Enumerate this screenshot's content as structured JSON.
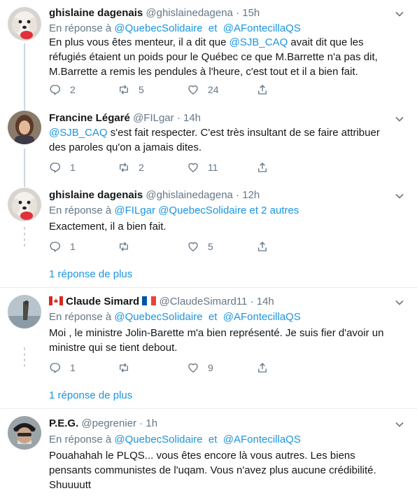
{
  "tweets": [
    {
      "name": "ghislaine dagenais",
      "handle": "@ghislainedagena",
      "dot": "·",
      "time": "15h",
      "reply_prefix": "En réponse à",
      "reply_m1": "@QuebecSolidaire",
      "reply_sep": "et",
      "reply_m2": "@AFontecillaQS",
      "text_line1_mention": "",
      "text": "En plus vous êtes menteur, il a dit que",
      "text_mention": "@SJB_CAQ",
      "text_rest": " avait dit que les réfugiés étaient un poids pour le Québec ce que M.Barrette n'a pas dit, M.Barrette a remis les pendules à l'heure, c'est tout et il a bien fait.",
      "replies": "2",
      "retweets": "5",
      "likes": "24",
      "avatar": "dog-avatar"
    },
    {
      "name": "Francine Légaré",
      "handle": "@FILgar",
      "dot": "·",
      "time": "14h",
      "text_mention": "@SJB_CAQ",
      "text_rest": " s'est fait respecter. C'est très insultant de se faire attribuer des paroles qu'on a jamais dites.",
      "replies": "1",
      "retweets": "2",
      "likes": "11",
      "avatar": "woman-avatar"
    },
    {
      "name": "ghislaine dagenais",
      "handle": "@ghislainedagena",
      "dot": "·",
      "time": "12h",
      "reply_prefix": "En réponse à",
      "reply_m1": "@FILgar",
      "reply_m2": "@QuebecSolidaire",
      "reply_others": "et 2 autres",
      "text": "Exactement, il a bien fait.",
      "replies": "1",
      "retweets": "",
      "likes": "5",
      "avatar": "dog-avatar"
    },
    {
      "name": "Claude Simard",
      "handle": "@ClaudeSimard11",
      "dot": "·",
      "time": "14h",
      "reply_prefix": "En réponse à",
      "reply_m1": "@QuebecSolidaire",
      "reply_sep": "et",
      "reply_m2": "@AFontecillaQS",
      "text": "Moi , le ministre Jolin-Barette m'a bien représenté. Je suis fier d'avoir un ministre qui se tient debout.",
      "replies": "1",
      "retweets": "",
      "likes": "9",
      "avatar": "bird-avatar"
    },
    {
      "name": "P.E.G.",
      "handle": "@pegrenier",
      "dot": "·",
      "time": "1h",
      "reply_prefix": "En réponse à",
      "reply_m1": "@QuebecSolidaire",
      "reply_sep": "et",
      "reply_m2": "@AFontecillaQS",
      "text": "Pouahahah le PLQS... vous êtes encore là vous autres.  Les biens pensants communistes de l'uqam.  Vous n'avez plus aucune crédibilité.  Shuuuutt",
      "avatar": "man-avatar"
    }
  ],
  "more_replies": [
    "1 réponse de plus",
    "1 réponse de plus"
  ],
  "colors": {
    "link": "#1b95e0",
    "muted": "#657786",
    "text": "#14171a",
    "line": "#ccd6dd"
  },
  "icons": [
    "reply-icon",
    "retweet-icon",
    "like-icon",
    "share-icon",
    "chevron-down-icon",
    "canada-flag-icon",
    "france-flag-icon"
  ]
}
